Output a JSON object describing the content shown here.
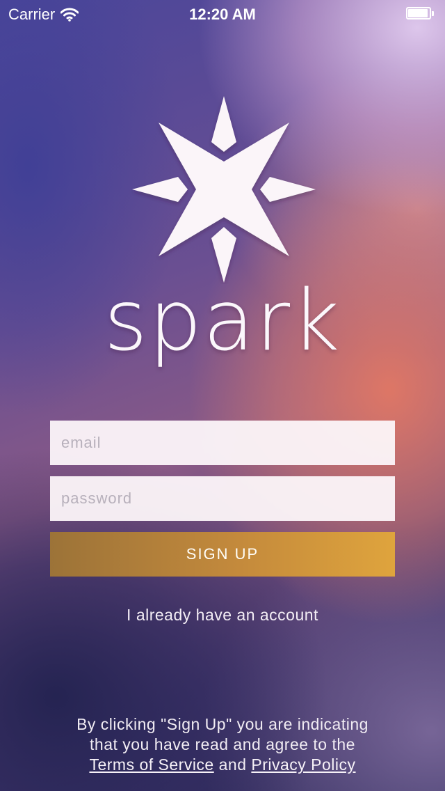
{
  "status_bar": {
    "carrier": "Carrier",
    "time": "12:20 AM",
    "wifi_icon": "wifi-icon",
    "battery_icon": "battery-icon"
  },
  "brand": {
    "logo_icon": "star-logo-icon",
    "name": "spark"
  },
  "form": {
    "email_placeholder": "email",
    "password_placeholder": "password",
    "signup_label": "SIGN UP",
    "signup_color": "#c9903e"
  },
  "login_link": "I already have an account",
  "legal": {
    "line1": "By clicking \"Sign Up\" you are indicating",
    "line2": "that you have read and agree to the",
    "terms_label": "Terms of Service",
    "and_text": "and",
    "privacy_label": "Privacy Policy"
  }
}
